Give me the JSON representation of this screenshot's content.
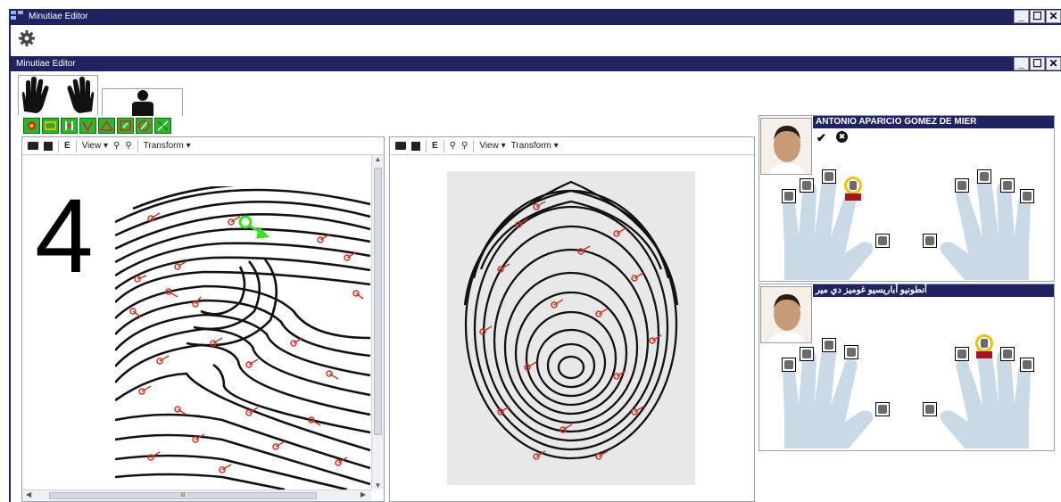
{
  "app": {
    "title": "Minutiae Editor",
    "inner_title": "Minutiae Editor"
  },
  "tabs": [
    {
      "name": "hands-tab",
      "icon": "hands-icon"
    },
    {
      "name": "person-tab",
      "icon": "person-icon"
    }
  ],
  "toolbar_icons": [
    "tool-1",
    "tool-2",
    "tool-3",
    "tool-4",
    "tool-5",
    "tool-6",
    "tool-7",
    "tool-8"
  ],
  "left_panel": {
    "view_label": "View",
    "transform_label": "Transform",
    "e_label": "E",
    "finger_number": "4"
  },
  "right_panel": {
    "view_label": "View",
    "transform_label": "Transform",
    "e_label": "E"
  },
  "cards": [
    {
      "name": "ANTONIO APARICIO GOMEZ DE MIER",
      "check": "✔",
      "cancel": "✖"
    },
    {
      "name": "أنطونيو أباريسيو غوميز دي مير"
    }
  ],
  "scroll": {
    "mid_label": "III"
  },
  "colors": {
    "title_bar": "#1f2461",
    "accent_green": "#2db52d",
    "hand": "#c9d9e6",
    "highlight": "#e0c21a",
    "selected_red": "#a2171f"
  }
}
